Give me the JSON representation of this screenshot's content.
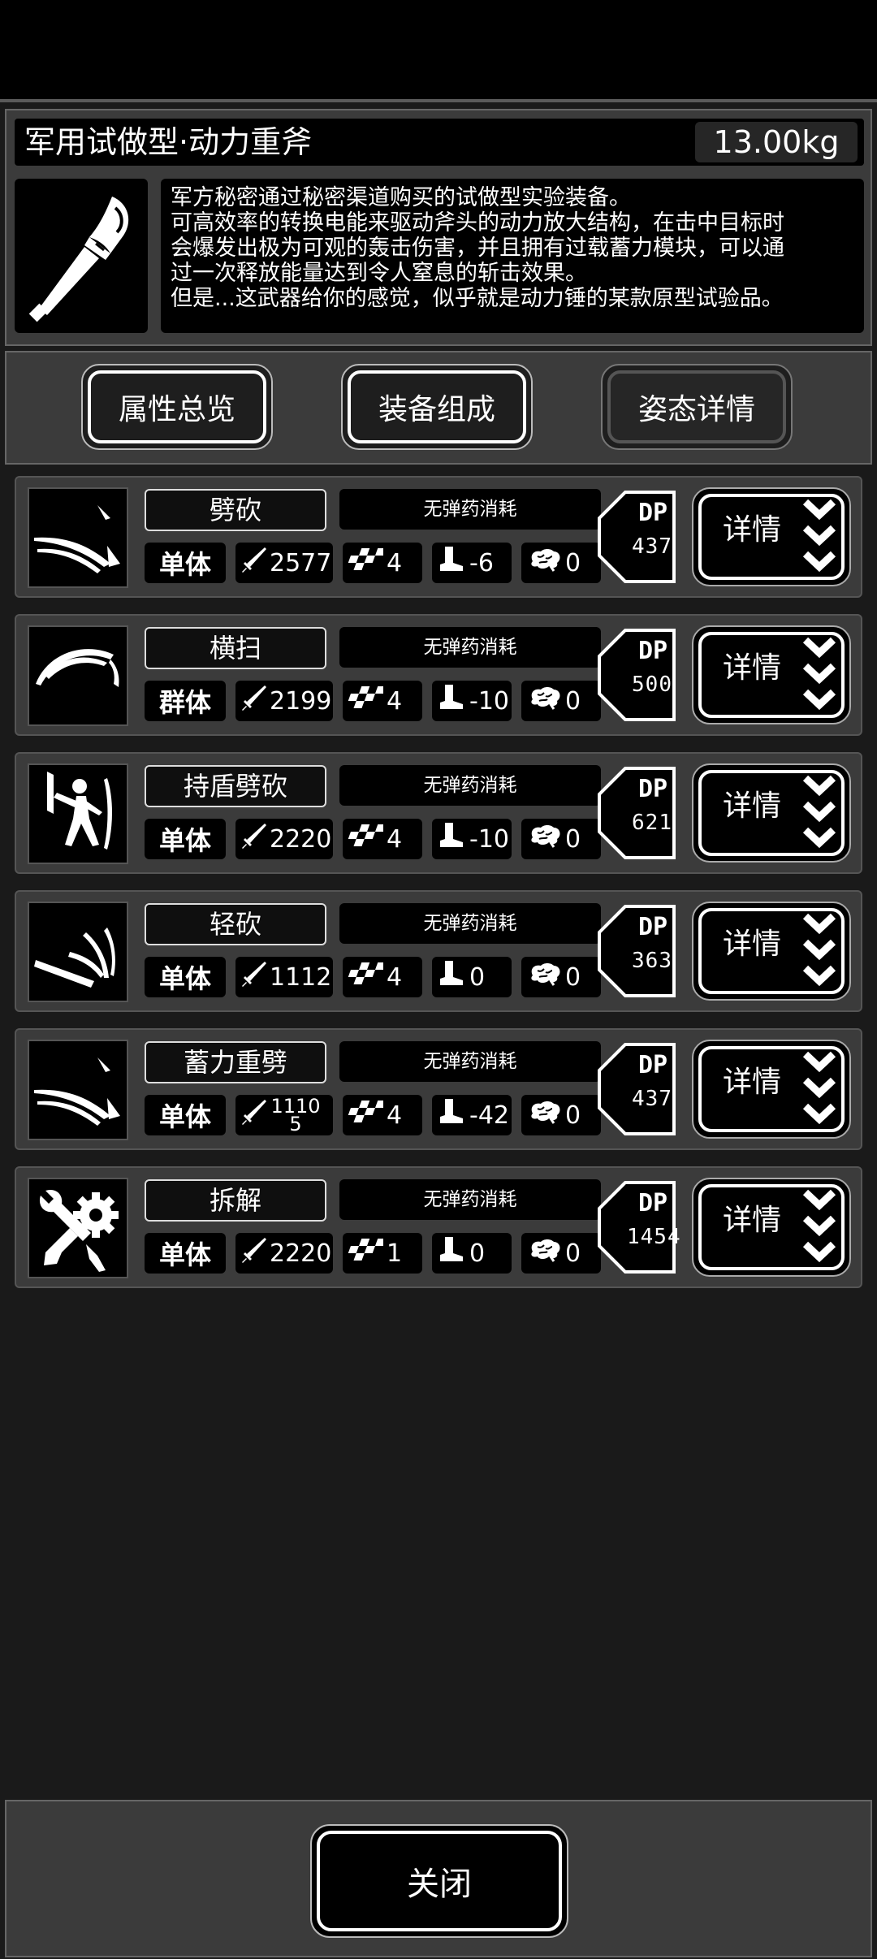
{
  "item": {
    "title": "军用试做型·动力重斧",
    "weight": "13.00kg",
    "icon": "power-axe-icon",
    "description": [
      "军方秘密通过秘密渠道购买的试做型实验装备。",
      "可高效率的转换电能来驱动斧头的动力放大结构，在击中目标时",
      "会爆发出极为可观的轰击伤害，并且拥有过载蓄力模块，可以通",
      "过一次释放能量达到令人窒息的斩击效果。",
      "但是...这武器给你的感觉，似乎就是动力锤的某款原型试验品。"
    ]
  },
  "tabs": [
    {
      "label": "属性总览",
      "active": false
    },
    {
      "label": "装备组成",
      "active": false
    },
    {
      "label": "姿态详情",
      "active": true
    }
  ],
  "dp_label": "DP",
  "detail_label": "详情",
  "moves": [
    {
      "name": "劈砍",
      "ammo": "无弹药消耗",
      "target": "单体",
      "attack": "2577",
      "speed": "4",
      "move": "-6",
      "mental": "0",
      "dp": "437",
      "icon": "slash-icon"
    },
    {
      "name": "横扫",
      "ammo": "无弹药消耗",
      "target": "群体",
      "attack": "2199",
      "speed": "4",
      "move": "-10",
      "mental": "0",
      "dp": "500",
      "icon": "sweep-icon"
    },
    {
      "name": "持盾劈砍",
      "ammo": "无弹药消耗",
      "target": "单体",
      "attack": "2220",
      "speed": "4",
      "move": "-10",
      "mental": "0",
      "dp": "621",
      "icon": "shield-fighter-icon"
    },
    {
      "name": "轻砍",
      "ammo": "无弹药消耗",
      "target": "单体",
      "attack": "1112",
      "speed": "4",
      "move": "0",
      "mental": "0",
      "dp": "363",
      "icon": "light-slash-icon"
    },
    {
      "name": "蓄力重劈",
      "ammo": "无弹药消耗",
      "target": "单体",
      "attack": "1110\n5",
      "speed": "4",
      "move": "-42",
      "mental": "0",
      "dp": "437",
      "icon": "charged-slash-icon"
    },
    {
      "name": "拆解",
      "ammo": "无弹药消耗",
      "target": "单体",
      "attack": "2220",
      "speed": "1",
      "move": "0",
      "mental": "0",
      "dp": "1454",
      "icon": "wrench-gear-icon"
    }
  ],
  "footer": {
    "close_label": "关闭"
  }
}
